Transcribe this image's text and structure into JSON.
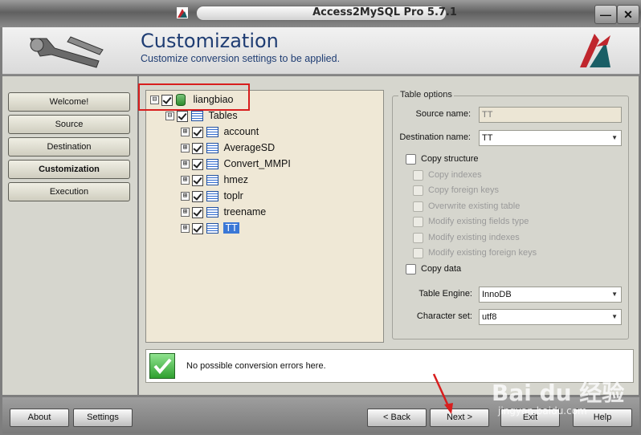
{
  "window": {
    "title": "Access2MySQL Pro 5.7.1",
    "minimize_glyph": "—",
    "close_glyph": "✕"
  },
  "header": {
    "title": "Customization",
    "subtitle": "Customize conversion settings to be applied."
  },
  "nav": {
    "items": [
      {
        "label": "Welcome!"
      },
      {
        "label": "Source"
      },
      {
        "label": "Destination"
      },
      {
        "label": "Customization",
        "active": true
      },
      {
        "label": "Execution"
      }
    ]
  },
  "tree": {
    "root": {
      "label": "liangbiao",
      "icon": "database-icon",
      "expander": "⊟"
    },
    "group": {
      "label": "Tables",
      "icon": "tables-icon",
      "expander": "⊟"
    },
    "tables": [
      {
        "label": "account"
      },
      {
        "label": "AverageSD"
      },
      {
        "label": "Convert_MMPI"
      },
      {
        "label": "hmez"
      },
      {
        "label": "toplr"
      },
      {
        "label": "treename"
      },
      {
        "label": "TT",
        "selected": true
      }
    ],
    "table_expander": "⊞"
  },
  "table_options": {
    "legend": "Table options",
    "source_name_label": "Source name:",
    "source_name_value": "TT",
    "destination_name_label": "Destination name:",
    "destination_name_value": "TT",
    "copy_structure_label": "Copy structure",
    "sub_options": [
      "Copy indexes",
      "Copy foreign keys",
      "Overwrite existing table",
      "Modify existing fields type",
      "Modify existing indexes",
      "Modify existing foreign keys"
    ],
    "copy_data_label": "Copy data",
    "table_engine_label": "Table Engine:",
    "table_engine_value": "InnoDB",
    "charset_label": "Character set:",
    "charset_value": "utf8"
  },
  "status": {
    "message": "No possible conversion errors here."
  },
  "footer": {
    "about_label": "About",
    "settings_label": "Settings",
    "back_label": "< Back",
    "next_label": "Next >",
    "exit_label": "Exit",
    "help_label": "Help"
  },
  "watermark": {
    "text": "Bai du 经验",
    "url": "jingyan.baidu.com"
  },
  "colors": {
    "accent": "#1f3d73",
    "highlight_box": "#d81e1e",
    "selection": "#3a77d6"
  }
}
